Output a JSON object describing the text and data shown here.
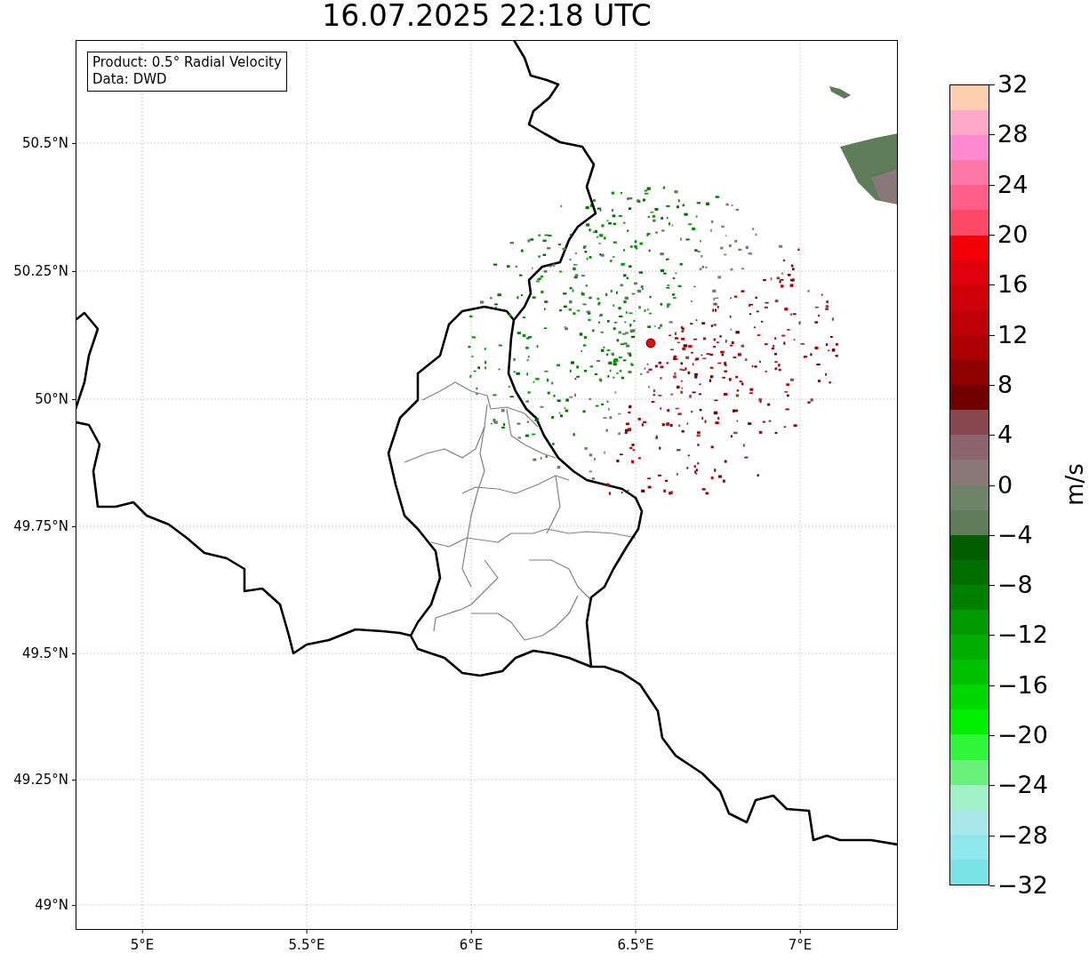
{
  "title": "16.07.2025 22:18 UTC",
  "info_box": [
    "Product: 0.5° Radial Velocity",
    "Data: DWD"
  ],
  "lat_labels": [
    "50.5°N",
    "50.25°N",
    "50°N",
    "49.75°N",
    "49.5°N",
    "49.25°N",
    "49°N"
  ],
  "lon_labels": [
    "5°E",
    "5.5°E",
    "6°E",
    "6.5°E",
    "7°E"
  ],
  "colorbar": {
    "label": "m/s",
    "ticks": [
      "32",
      "28",
      "24",
      "20",
      "16",
      "12",
      "8",
      "4",
      "0",
      "−4",
      "−8",
      "−12",
      "−16",
      "−20",
      "−24",
      "−28",
      "−32"
    ],
    "bands": [
      {
        "color": "#ffcfb0"
      },
      {
        "color": "#ffa8c8"
      },
      {
        "color": "#ff88d0"
      },
      {
        "color": "#ff78a8"
      },
      {
        "color": "#ff5e88"
      },
      {
        "color": "#ff4868"
      },
      {
        "color": "#f20008"
      },
      {
        "color": "#e0000c"
      },
      {
        "color": "#d0000a"
      },
      {
        "color": "#bf0008"
      },
      {
        "color": "#aa0004"
      },
      {
        "color": "#8f0000"
      },
      {
        "color": "#700000"
      },
      {
        "color": "#88464e"
      },
      {
        "color": "#8c6470"
      },
      {
        "color": "#8a7878"
      },
      {
        "color": "#6e8468"
      },
      {
        "color": "#5e7c58"
      },
      {
        "color": "#005e00"
      },
      {
        "color": "#006e00"
      },
      {
        "color": "#008000"
      },
      {
        "color": "#009a00"
      },
      {
        "color": "#00ad00"
      },
      {
        "color": "#00c000"
      },
      {
        "color": "#00d800"
      },
      {
        "color": "#00f000"
      },
      {
        "color": "#30f838"
      },
      {
        "color": "#68f27c"
      },
      {
        "color": "#a0f0c8"
      },
      {
        "color": "#a8e8ec"
      },
      {
        "color": "#90e8ec"
      },
      {
        "color": "#78e4e8"
      }
    ]
  }
}
